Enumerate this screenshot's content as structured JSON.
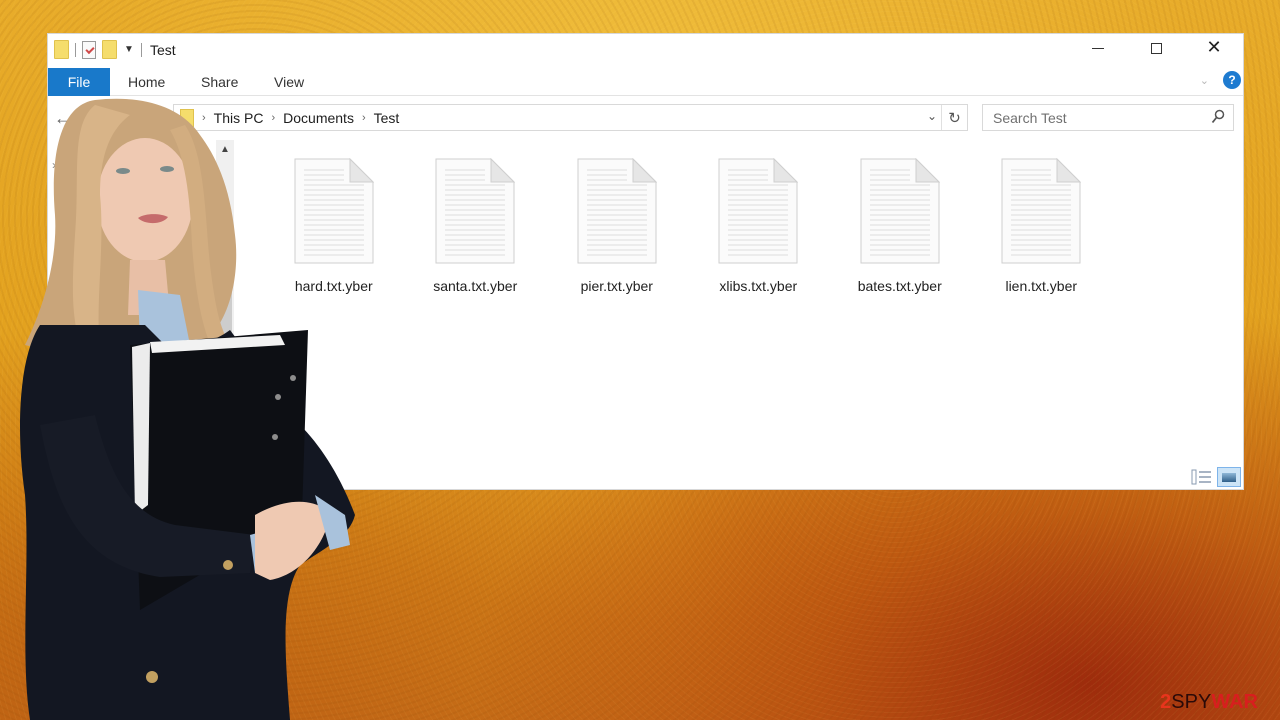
{
  "window": {
    "title": "Test",
    "controls": {
      "minimize": "minimize",
      "maximize": "maximize",
      "close": "close"
    }
  },
  "ribbon": {
    "tabs": [
      {
        "label": "File",
        "active": true
      },
      {
        "label": "Home"
      },
      {
        "label": "Share"
      },
      {
        "label": "View"
      }
    ],
    "help_label": "?"
  },
  "address_bar": {
    "breadcrumb": [
      "This PC",
      "Documents",
      "Test"
    ]
  },
  "search": {
    "placeholder": "Search Test",
    "value": ""
  },
  "files": [
    {
      "name": "hard.txt.yber",
      "icon": "text-document-icon"
    },
    {
      "name": "santa.txt.yber",
      "icon": "text-document-icon"
    },
    {
      "name": "pier.txt.yber",
      "icon": "text-document-icon"
    },
    {
      "name": "xlibs.txt.yber",
      "icon": "text-document-icon"
    },
    {
      "name": "bates.txt.yber",
      "icon": "text-document-icon"
    },
    {
      "name": "lien.txt.yber",
      "icon": "text-document-icon"
    }
  ],
  "view_modes": {
    "details": "details-view",
    "large_icons": "large-icons-view",
    "active": "large_icons"
  },
  "watermark": {
    "part1": "2",
    "part2": "SPY",
    "part3": "WAR"
  },
  "colors": {
    "file_tab": "#1979ca",
    "help": "#1e7bd0",
    "folder": "#f5dd6c",
    "background": "#e3a21f"
  }
}
